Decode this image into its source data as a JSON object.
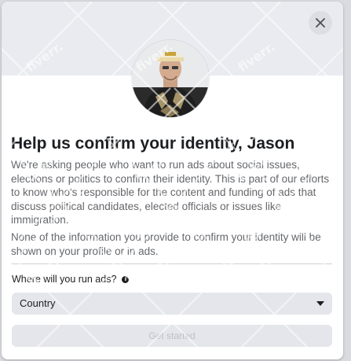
{
  "modal": {
    "title": "Help us confirm your identity, Jason",
    "paragraphs": [
      "We're asking people who want to run ads about social issues, elections or politics to confirm their identity. This is part of our efforts to know who's responsible for the content and funding of ads that discuss political candidates, elected officials or issues like immigration.",
      "None of the information you provide to confirm your identity will be shown on your profile or in ads."
    ],
    "question": "Where will you run ads?",
    "country_select": {
      "value": "Country"
    },
    "primary_button": {
      "label": "Get started",
      "disabled": true
    },
    "close_icon": "close-icon",
    "info_icon": "info-icon"
  },
  "watermark": {
    "text": "fiverr."
  },
  "colors": {
    "title": "#1c1e21",
    "body": "#65676b",
    "banner": "#e9ebf0",
    "control_bg": "#e4e6eb",
    "disabled_text": "#bcc0c4"
  }
}
